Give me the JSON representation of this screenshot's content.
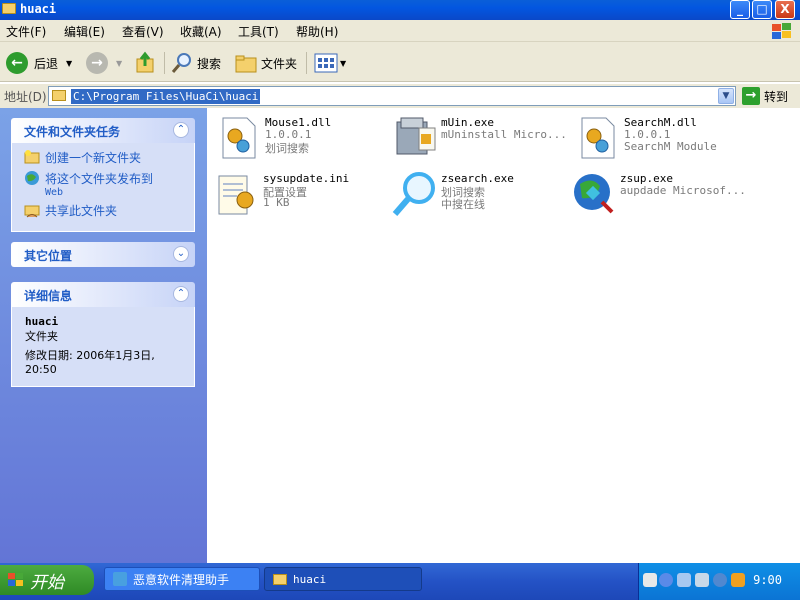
{
  "window": {
    "title": "huaci",
    "controls": {
      "minimize": "_",
      "maximize": "□",
      "close": "X"
    }
  },
  "menu": [
    "文件(F)",
    "编辑(E)",
    "查看(V)",
    "收藏(A)",
    "工具(T)",
    "帮助(H)"
  ],
  "toolbar": {
    "back_label": "后退",
    "search_label": "搜索",
    "folders_label": "文件夹"
  },
  "address": {
    "label": "地址(D)",
    "path": "C:\\Program Files\\HuaCi\\huaci",
    "go_label": "转到"
  },
  "left_panels": {
    "tasks": {
      "title": "文件和文件夹任务",
      "items": [
        {
          "label": "创建一个新文件夹",
          "icon": "new-folder-icon"
        },
        {
          "label": "将这个文件夹发布到",
          "sub": "Web",
          "icon": "globe-icon"
        },
        {
          "label": "共享此文件夹",
          "icon": "share-folder-icon"
        }
      ]
    },
    "other_places": {
      "title": "其它位置"
    },
    "details": {
      "title": "详细信息",
      "name": "huaci",
      "type": "文件夹",
      "modified": "修改日期: 2006年1月3日, 20:50"
    }
  },
  "files": [
    {
      "name": "Mouse1.dll",
      "line2": "1.0.0.1",
      "line3": "划词搜索",
      "icon": "dll-gear-icon"
    },
    {
      "name": "mUin.exe",
      "line2": "mUninstall Micro...",
      "line3": "",
      "icon": "uninstall-icon"
    },
    {
      "name": "SearchM.dll",
      "line2": "1.0.0.1",
      "line3": "SearchM Module",
      "icon": "dll-gear-icon"
    },
    {
      "name": "sysupdate.ini",
      "line2": "配置设置",
      "line3": "1 KB",
      "icon": "ini-file-icon"
    },
    {
      "name": "zsearch.exe",
      "line2": "划词搜索",
      "line3": "中搜在线",
      "icon": "magnifier-icon"
    },
    {
      "name": "zsup.exe",
      "line2": "aupdade Microsof...",
      "line3": "",
      "icon": "globe-app-icon"
    }
  ],
  "taskbar": {
    "start_label": "开始",
    "items": [
      {
        "label": "恶意软件清理助手"
      },
      {
        "label": "huaci"
      }
    ],
    "clock": "9:00"
  },
  "colors": {
    "title_blue": "#0a5fd8",
    "panel_blue": "#215dc6",
    "task_green": "#2f8a25"
  }
}
